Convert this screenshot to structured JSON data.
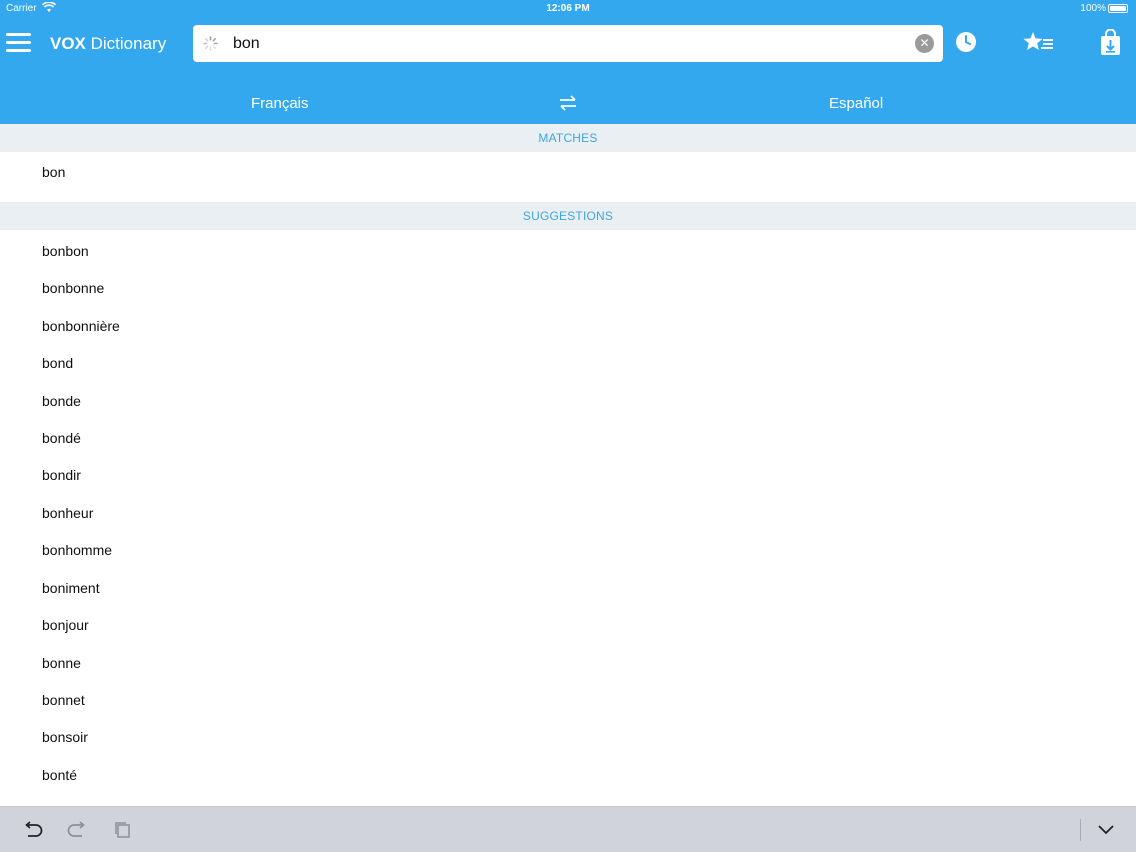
{
  "status_bar": {
    "carrier": "Carrier",
    "time": "12:06 PM",
    "battery": "100%"
  },
  "header": {
    "brand_bold": "VOX",
    "brand_rest": " Dictionary",
    "search_value": "bon",
    "source_language": "Français",
    "target_language": "Español",
    "accent_color": "#33a8ee"
  },
  "matches": {
    "header": "MATCHES",
    "items": [
      "bon"
    ]
  },
  "suggestions": {
    "header": "SUGGESTIONS",
    "items": [
      "bonbon",
      "bonbonne",
      "bonbonnière",
      "bond",
      "bonde",
      "bondé",
      "bondir",
      "bonheur",
      "bonhomme",
      "boniment",
      "bonjour",
      "bonne",
      "bonnet",
      "bonsoir",
      "bonté"
    ]
  },
  "icons": {
    "menu": "hamburger-menu-icon",
    "spinner": "loading-spinner-icon",
    "clear": "clear-icon",
    "history": "clock-icon",
    "favorites": "star-list-icon",
    "download": "download-bag-icon",
    "swap": "swap-arrows-icon",
    "undo": "undo-icon",
    "redo": "redo-icon",
    "paste": "clipboard-icon",
    "hide_keyboard": "chevron-down-icon"
  }
}
